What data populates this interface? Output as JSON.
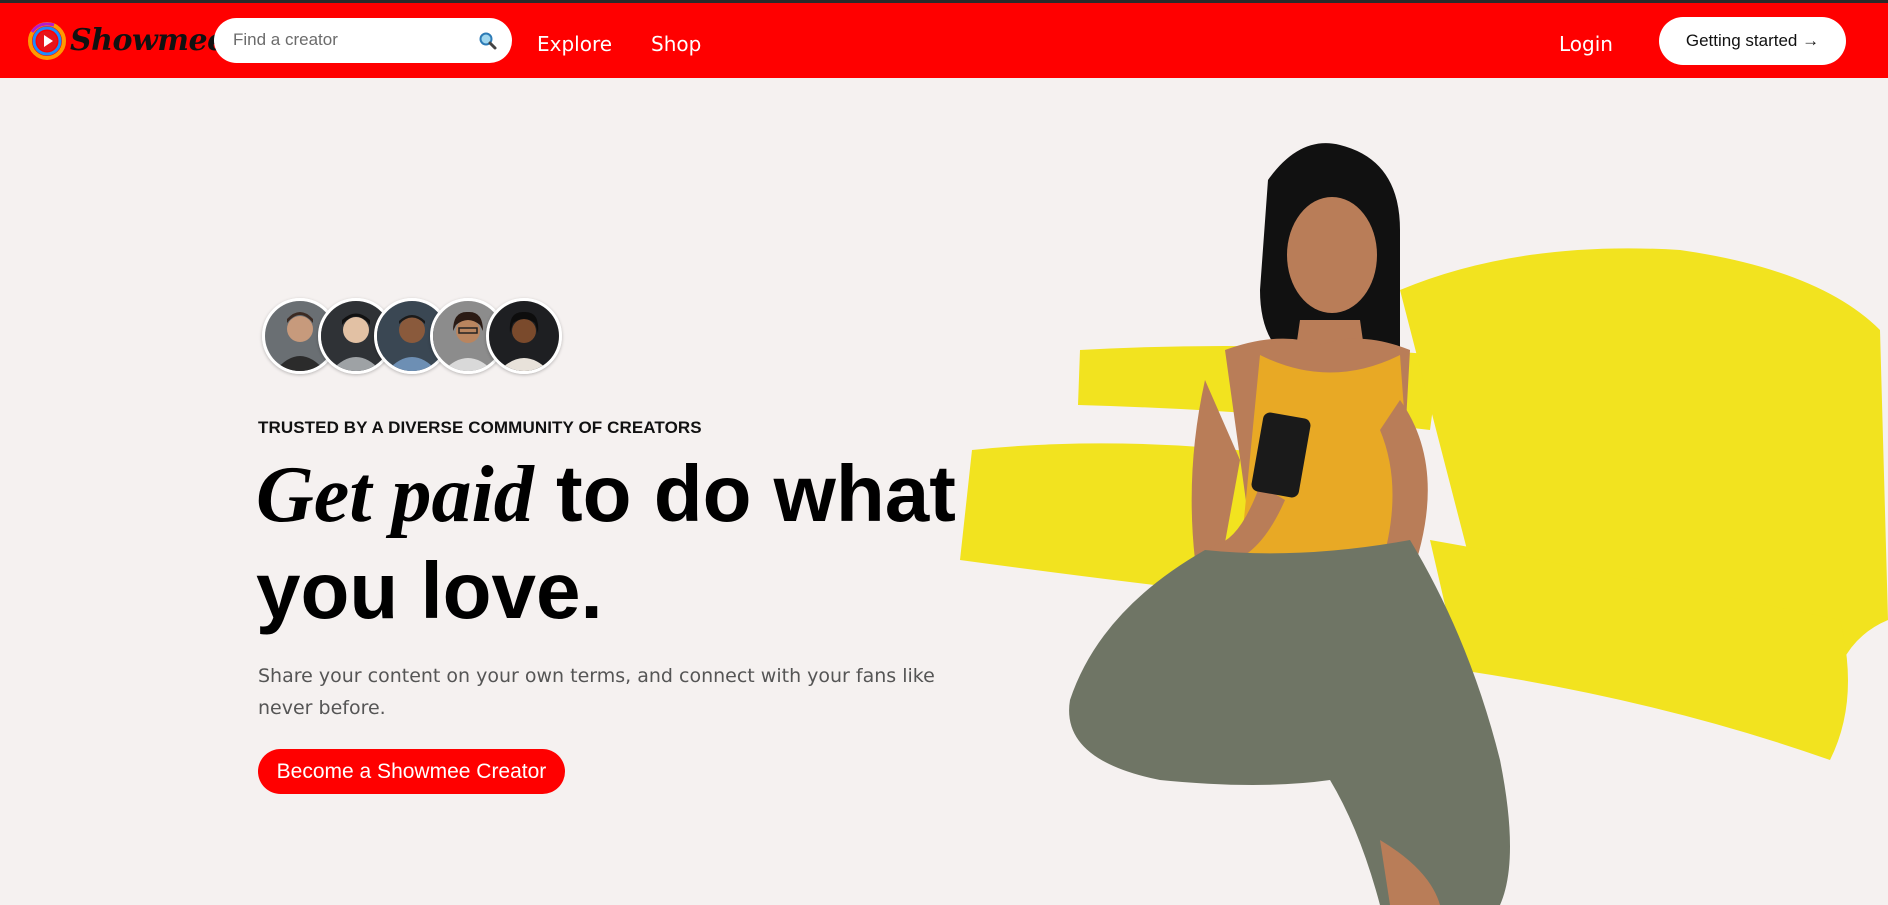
{
  "brand": {
    "name": "Showmee"
  },
  "search": {
    "placeholder": "Find a creator"
  },
  "nav": {
    "explore": "Explore",
    "shop": "Shop",
    "login": "Login",
    "getting_started": "Getting started →"
  },
  "hero": {
    "trusted_text": "TRUSTED BY A DIVERSE COMMUNITY OF CREATORS",
    "headline_italic": "Get paid",
    "headline_rest": " to do what you love.",
    "subtitle": "Share your content on your own terms, and connect with your fans like never before.",
    "cta_label": "Become a Showmee Creator"
  },
  "avatars": [
    {
      "name": "creator-avatar-1"
    },
    {
      "name": "creator-avatar-2"
    },
    {
      "name": "creator-avatar-3"
    },
    {
      "name": "creator-avatar-4"
    },
    {
      "name": "creator-avatar-5"
    }
  ],
  "colors": {
    "brand_red": "#ff0000",
    "page_background": "#f5f1f0",
    "accent_yellow": "#f2e31f"
  },
  "icons": {
    "search": "search-icon",
    "logo": "play-logo-icon"
  }
}
